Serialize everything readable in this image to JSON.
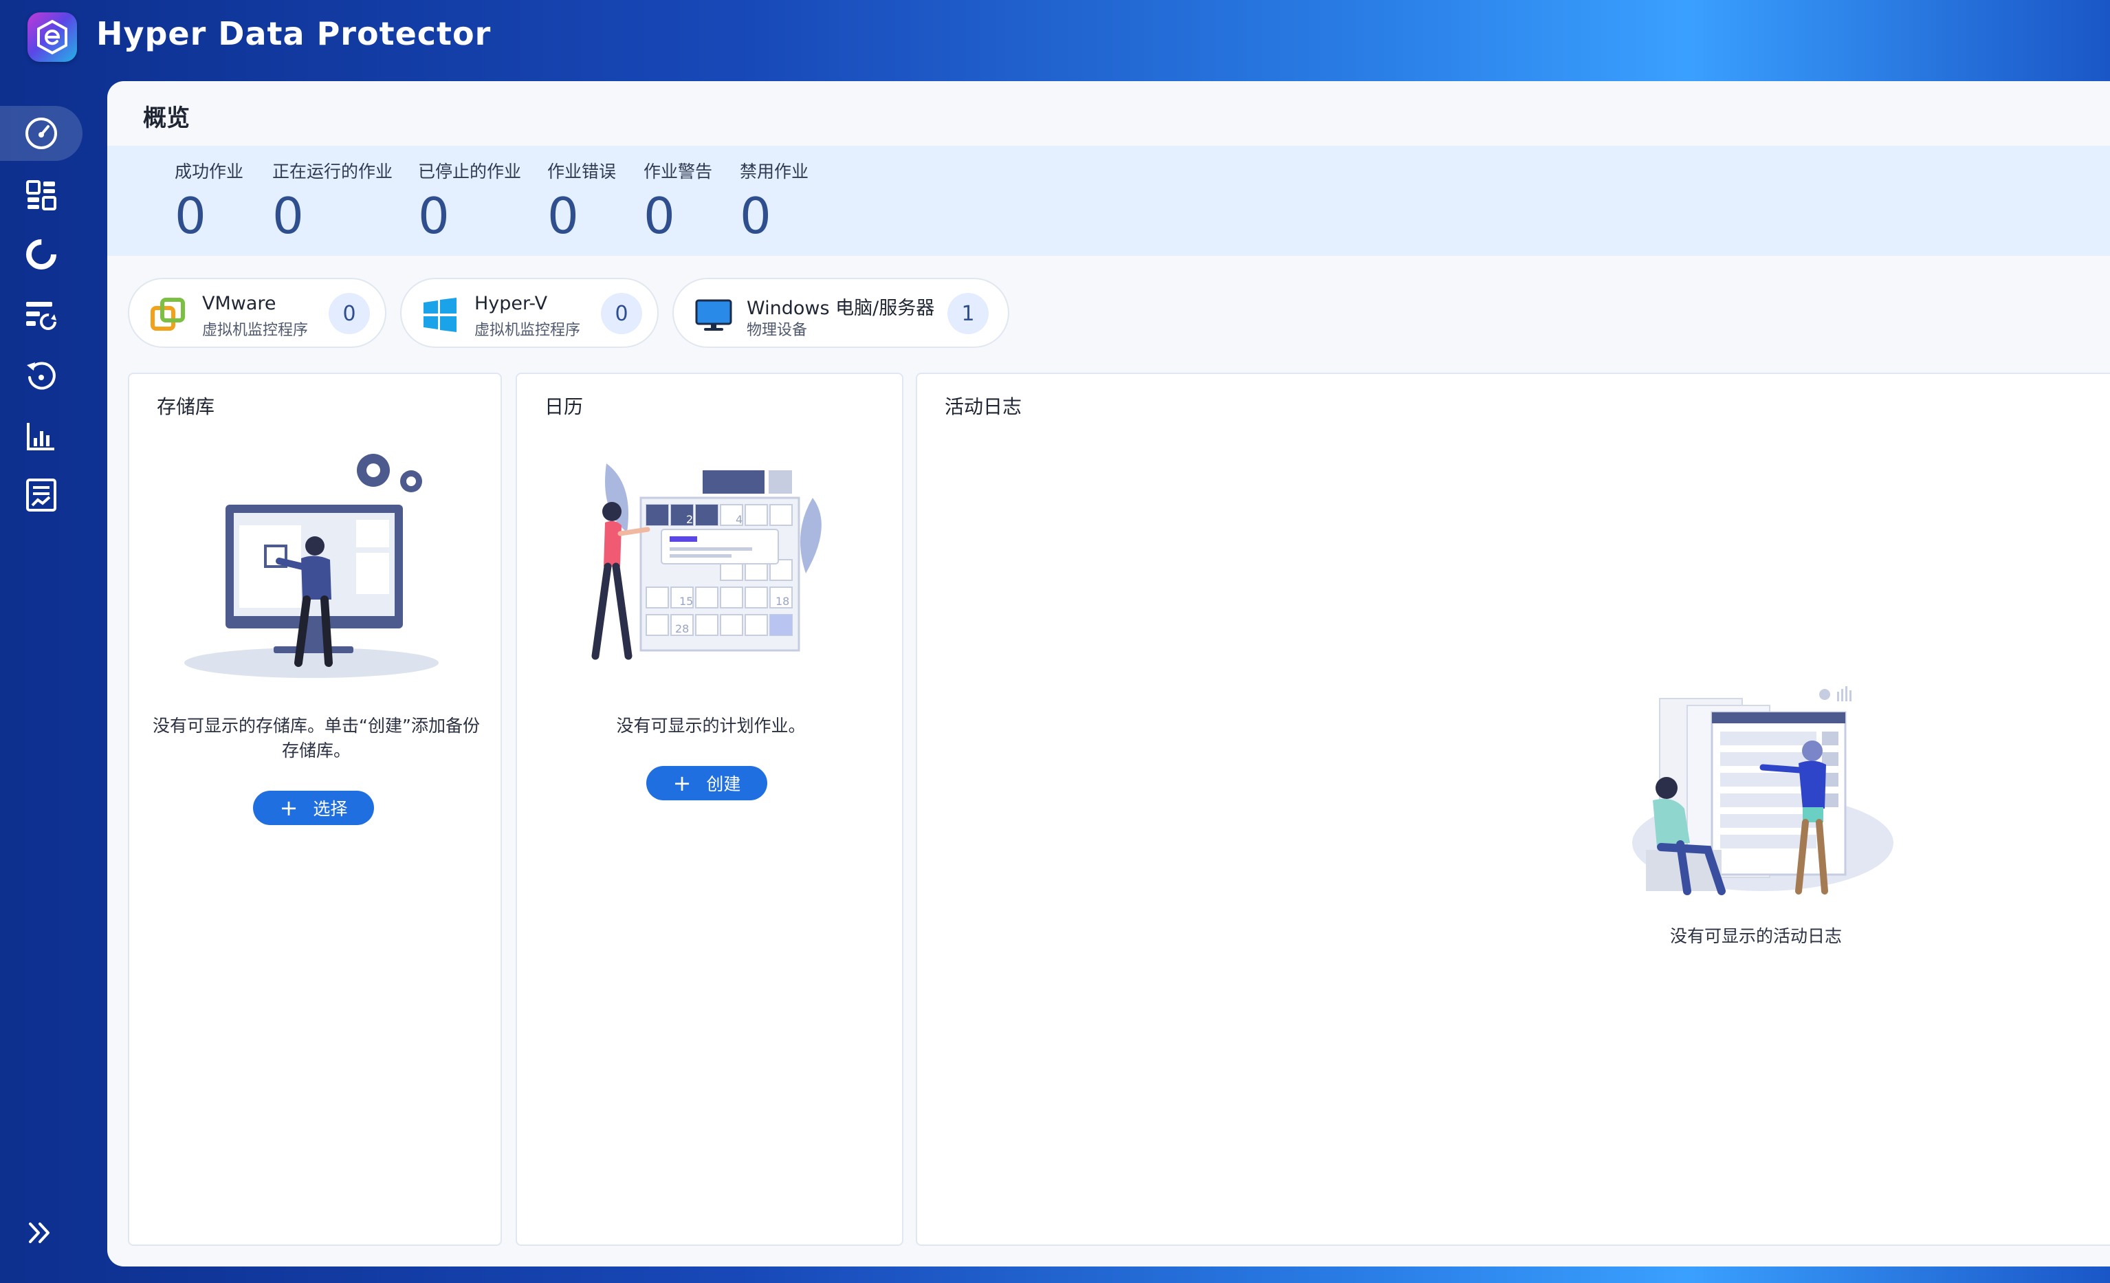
{
  "app": {
    "title": "Hyper Data Protector"
  },
  "page": {
    "title": "概览"
  },
  "stats": [
    {
      "label": "成功作业",
      "value": "0"
    },
    {
      "label": "正在运行的作业",
      "value": "0"
    },
    {
      "label": "已停止的作业",
      "value": "0"
    },
    {
      "label": "作业错误",
      "value": "0"
    },
    {
      "label": "作业警告",
      "value": "0"
    },
    {
      "label": "禁用作业",
      "value": "0"
    }
  ],
  "platforms": [
    {
      "name": "VMware",
      "sub": "虚拟机监控程序",
      "count": "0",
      "icon": "vmware-icon"
    },
    {
      "name": "Hyper-V",
      "sub": "虚拟机监控程序",
      "count": "0",
      "icon": "windows-icon"
    },
    {
      "name": "Windows 电脑/服务器",
      "sub": "物理设备",
      "count": "1",
      "icon": "monitor-icon"
    }
  ],
  "cards": {
    "storage": {
      "title": "存储库",
      "empty_text": "没有可显示的存储库。单击“创建”添加备份存储库。",
      "button": "选择"
    },
    "calendar": {
      "title": "日历",
      "empty_text": "没有可显示的计划作业。",
      "button": "创建"
    },
    "activity": {
      "title": "活动日志",
      "empty_text": "没有可显示的活动日志"
    }
  },
  "sidebar": {
    "items": [
      "overview-icon",
      "dashboard-icon",
      "storage-icon",
      "backup-jobs-icon",
      "restore-icon",
      "reports-icon",
      "logs-icon"
    ],
    "expand": "expand-icon"
  },
  "illustration": {
    "calendar_days": [
      "2",
      "4",
      "15",
      "18",
      "28"
    ]
  },
  "colors": {
    "accent": "#1f6fe0",
    "value_text": "#2e4e8e",
    "strip": "#e4efff"
  }
}
